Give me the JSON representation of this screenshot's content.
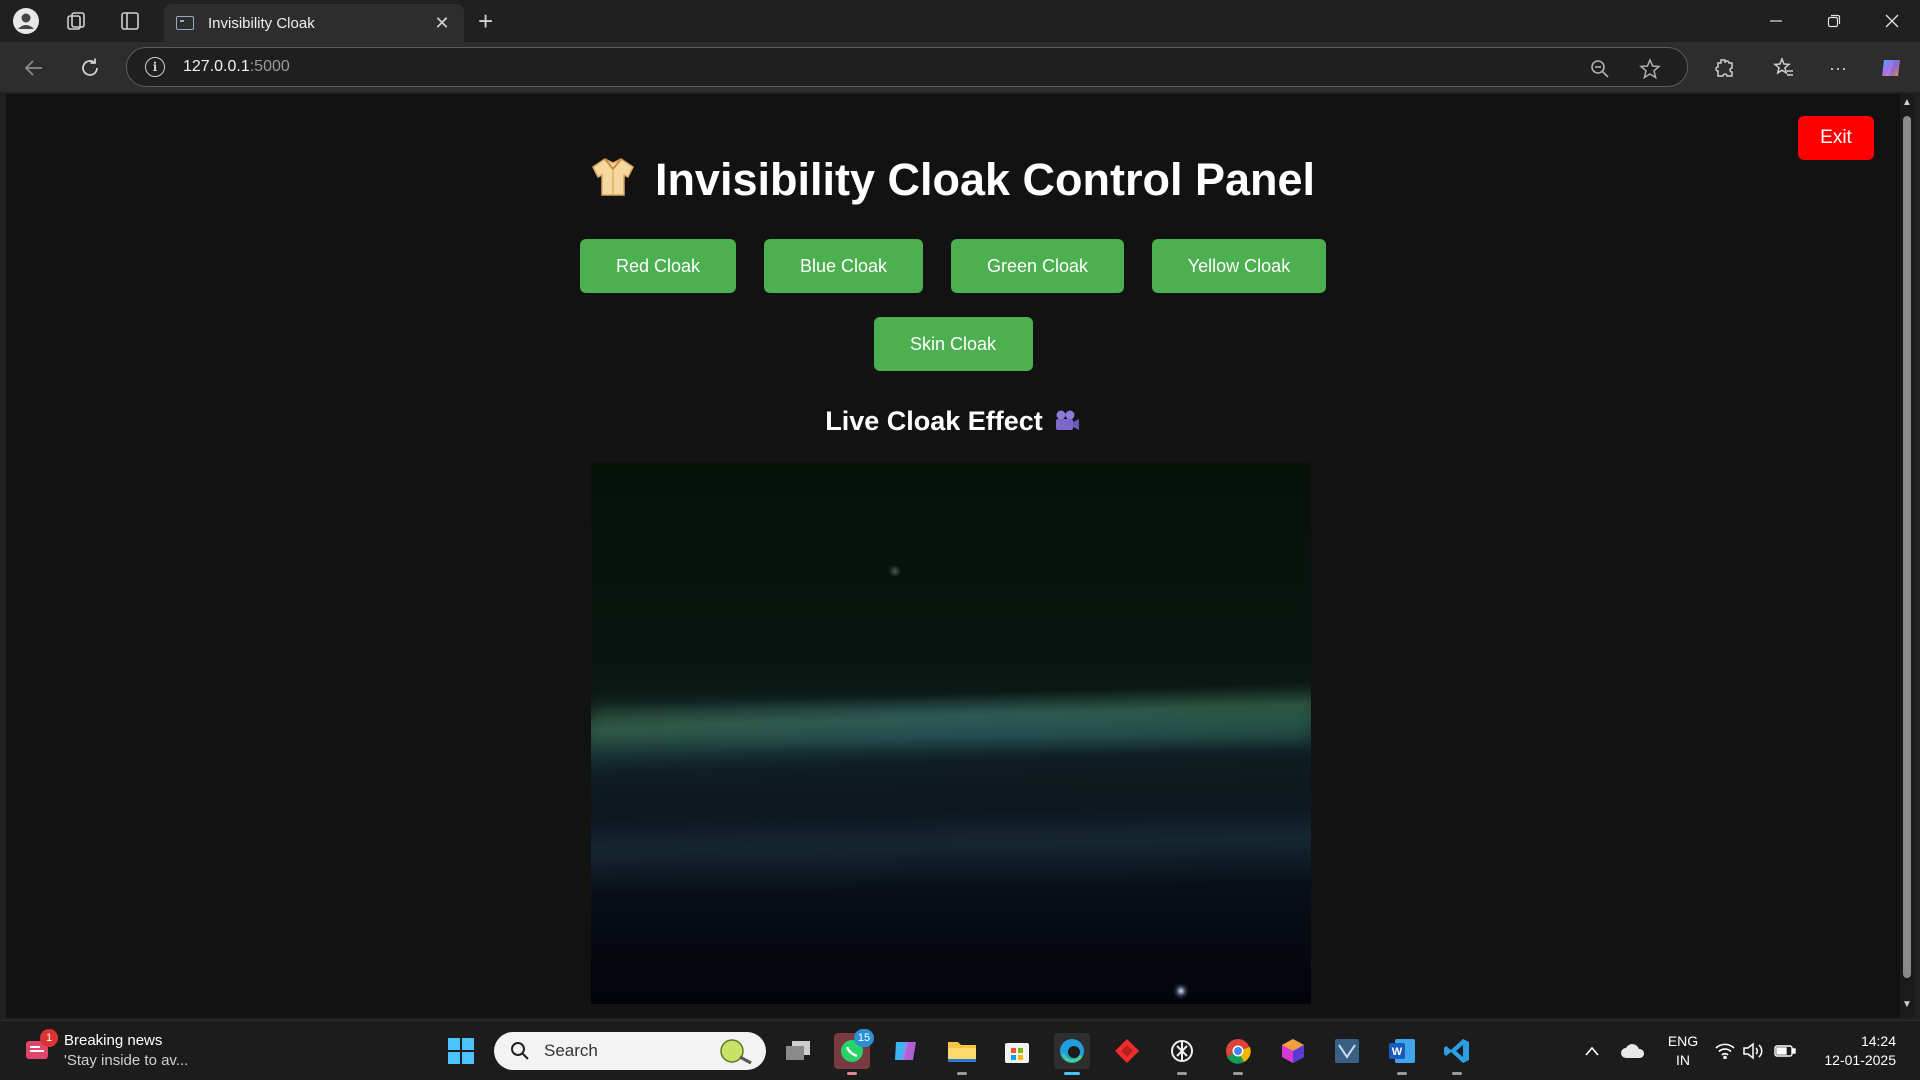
{
  "browser": {
    "tab_title": "Invisibility Cloak",
    "url_host": "127.0.0.1",
    "url_port": ":5000"
  },
  "page": {
    "exit_label": "Exit",
    "title": "Invisibility Cloak Control Panel",
    "buttons": [
      "Red Cloak",
      "Blue Cloak",
      "Green Cloak",
      "Yellow Cloak",
      "Skin Cloak"
    ],
    "live_title": "Live Cloak Effect",
    "colors": {
      "background": "#121212",
      "button": "#4caf50",
      "exit": "#ff0000"
    }
  },
  "taskbar": {
    "news_badge": "1",
    "news_title": "Breaking news",
    "news_sub": "'Stay inside to av...",
    "search_label": "Search",
    "whatsapp_badge": "15",
    "lang_line1": "ENG",
    "lang_line2": "IN",
    "time": "14:24",
    "date": "12-01-2025"
  }
}
